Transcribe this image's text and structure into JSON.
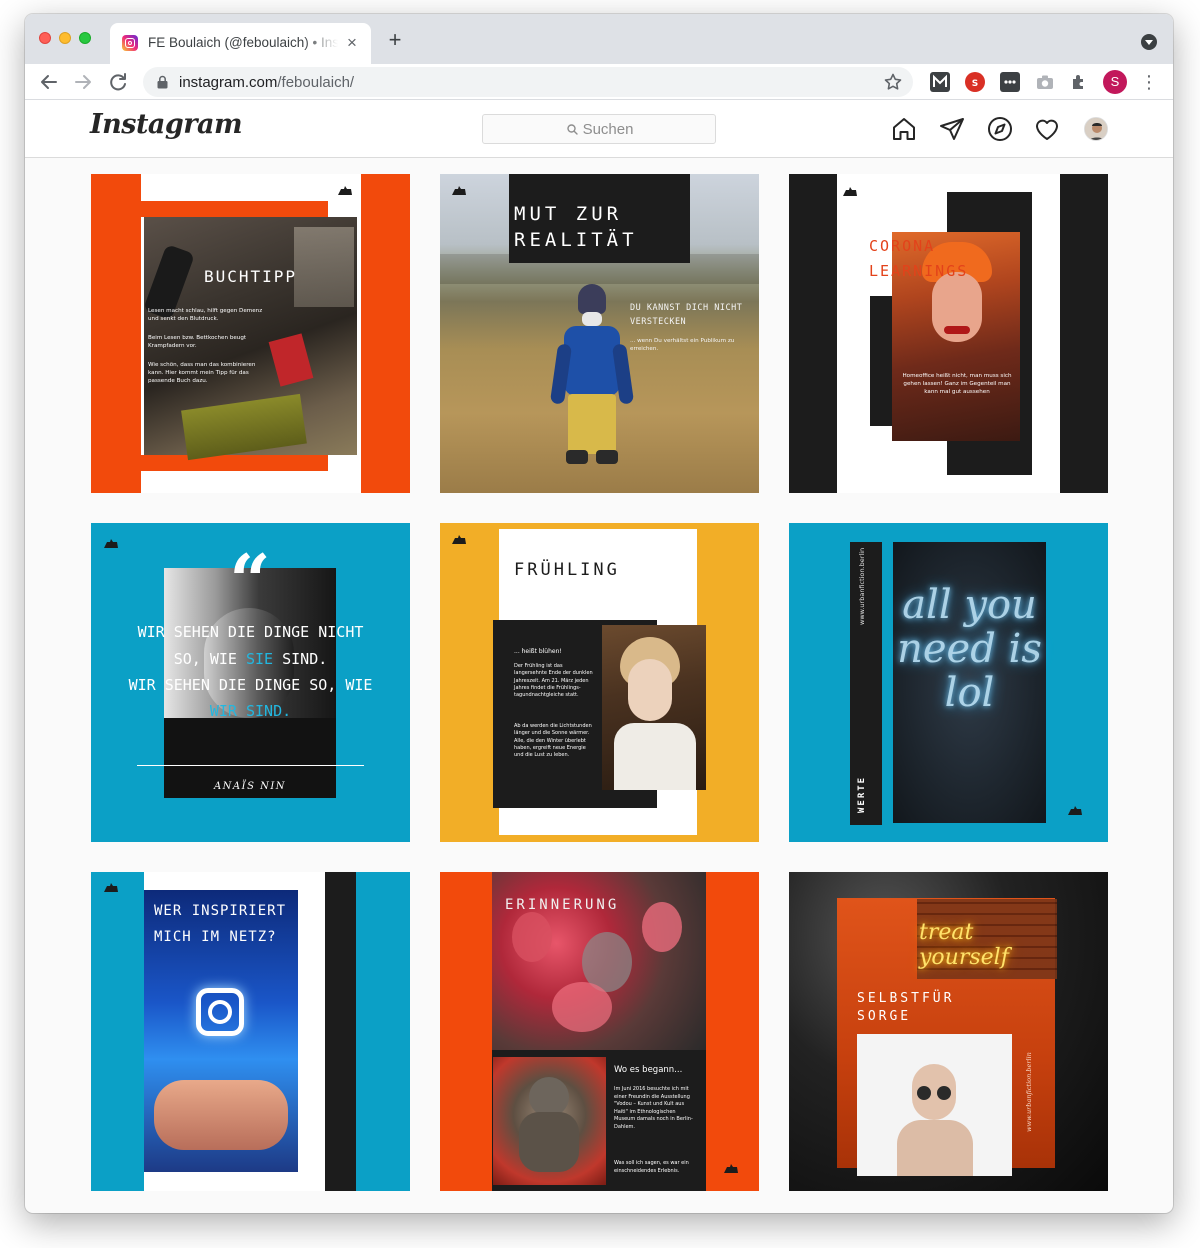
{
  "browser": {
    "tab_title": "FE Boulaich (@feboulaich) • Instagram-Fotos und -Videos",
    "tab_close": "×",
    "new_tab": "+",
    "url_host": "instagram.com",
    "url_path": "/feboulaich/",
    "profile_initial": "S",
    "menu_glyph": "⋮"
  },
  "instagram": {
    "logo": "Instagram",
    "search_placeholder": "Suchen"
  },
  "posts": {
    "buchtipp": {
      "title": "BUCHTIPP",
      "body1": "Lesen macht schlau, hilft gegen Demenz und senkt den Blutdruck.",
      "body2": "Beim Lesen bzw. Bettkochen beugt Krampfadern vor.",
      "body3": "Wie schön, dass man das kombinieren kann. Hier kommt mein Tipp für das passende Buch dazu."
    },
    "mut_zur_realitaet": {
      "title_line1": "MUT ZUR",
      "title_line2": "REALITÄT",
      "sub1": "DU KANNST DICH NICHT",
      "sub2": "VERSTECKEN",
      "sub3": "... wenn Du verhältst ein Publikum zu erreichen."
    },
    "corona": {
      "title_line1": "CORONA",
      "title_line2": "LEARNINGS",
      "body": "Homeoffice heißt nicht, man muss sich gehen lassen! Ganz im Gegenteil man kann mal gut aussehen"
    },
    "quote": {
      "quote_mark": "“",
      "line1": "WIR SEHEN DIE DINGE NICHT",
      "line2a": "SO, WIE ",
      "line2b": "SIE",
      "line2c": " SIND.",
      "line3": "WIR SEHEN DIE DINGE SO, WIE",
      "line4": "WIR SIND.",
      "author": "ANAÏS NIN"
    },
    "fruehling": {
      "title": "FRÜHLING",
      "lead": "... heißt blühen!",
      "body1": "Der Frühling ist das langersehnte Ende der dunklen Jahreszeit. Am 21. März jeden Jahres findet die Frühlings-tagundnachtgleiche statt.",
      "body2": "Ab da werden die Lichtstunden länger und die Sonne wärmer. Alle, die den Winter überlebt haben, ergreift neue Energie und die Lust zu leben."
    },
    "werte": {
      "url": "www.urbanfiction.berlin",
      "label": "WERTE",
      "neon": "all you need is lol"
    },
    "wer_inspiriert": {
      "title_line1": "WER INSPIRIERT",
      "title_line2": "MICH IM NETZ?"
    },
    "erinnerung": {
      "title": "ERINNERUNG",
      "subtitle": "Wo es begann...",
      "body": "Im Juni 2016 besuchte ich mit einer Freundin die Ausstellung \"Vodou – Kunst und Kult aus Haiti\" im Ethnologischen Museum damals noch in Berlin-Dahlem.",
      "body2": "Was soll ich sagen, es war ein einschneidendes Erlebnis."
    },
    "selbstfuersorge": {
      "neon": "treat yourself",
      "title_line1": "SELBSTFÜR",
      "title_line2": "SORGE",
      "url": "www.urbanfiction.berlin"
    }
  },
  "colors": {
    "orange": "#f24a0c",
    "black": "#1c1c1c",
    "blue": "#0ba0c6",
    "yellow": "#f2ae27",
    "white": "#ffffff"
  }
}
